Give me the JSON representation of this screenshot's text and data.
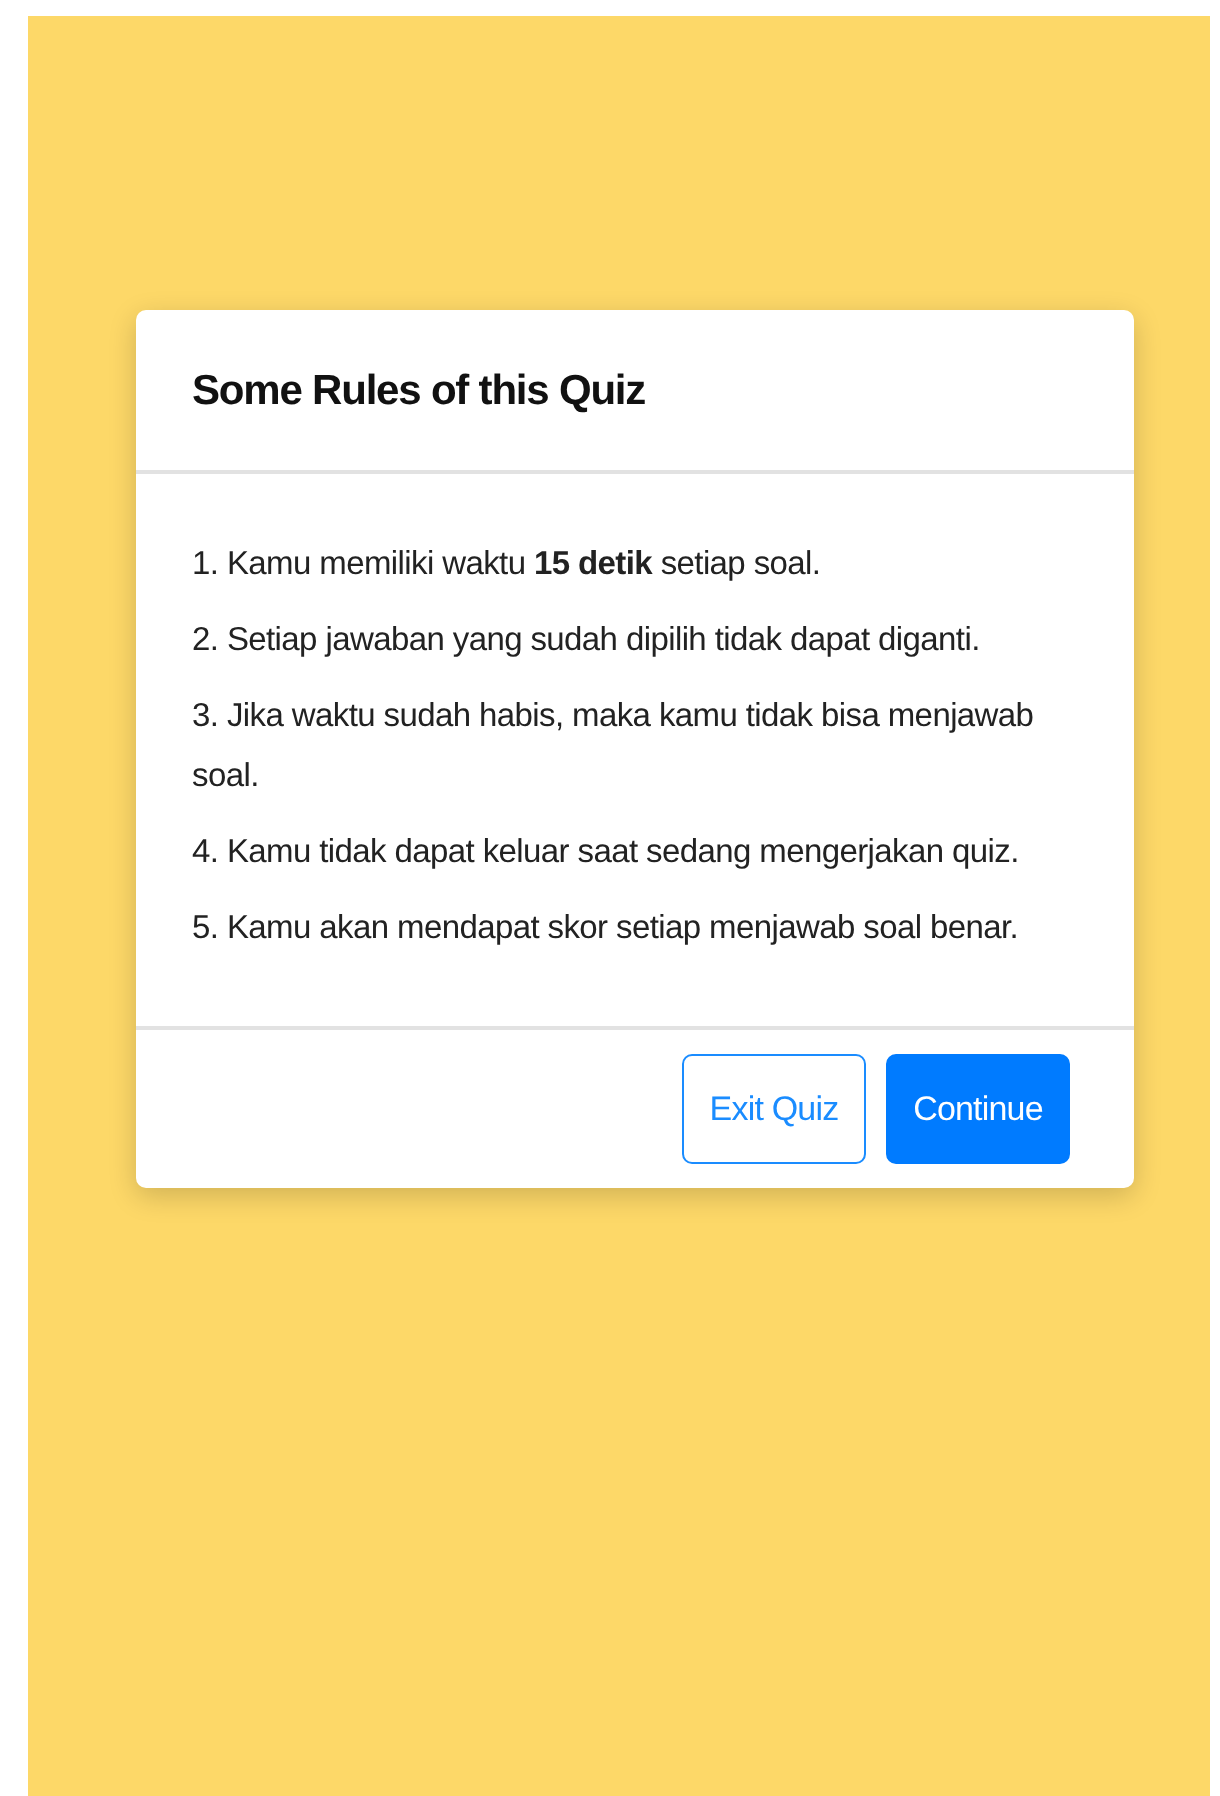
{
  "dialog": {
    "title": "Some Rules of this Quiz",
    "rules": [
      "1. Kamu memiliki waktu **15 detik** setiap soal.",
      "2. Setiap jawaban yang sudah dipilih tidak dapat diganti.",
      "3. Jika waktu sudah habis, maka kamu tidak bisa menjawab soal.",
      "4. Kamu tidak dapat keluar saat sedang mengerjakan quiz.",
      "5. Kamu akan mendapat skor setiap menjawab soal benar."
    ],
    "buttons": [
      {
        "label": "Exit Quiz",
        "kind": "outline"
      },
      {
        "label": "Continue",
        "kind": "primary"
      }
    ]
  }
}
